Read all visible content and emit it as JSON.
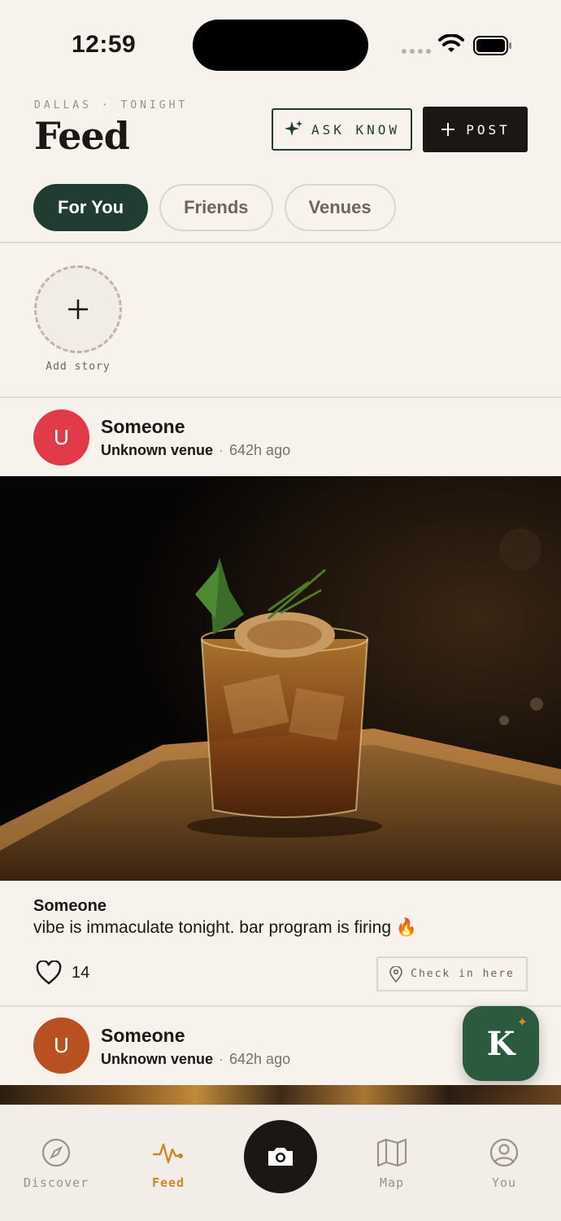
{
  "status_bar": {
    "time": "12:59"
  },
  "header": {
    "kicker": "DALLAS · TONIGHT",
    "title": "Feed",
    "ask_label": "ASK KNOW",
    "post_label": "POST"
  },
  "tabs": [
    {
      "label": "For You",
      "active": true
    },
    {
      "label": "Friends",
      "active": false
    },
    {
      "label": "Venues",
      "active": false
    }
  ],
  "stories": {
    "add_label": "Add story"
  },
  "posts": [
    {
      "avatar_letter": "U",
      "avatar_color": "#e23a48",
      "author": "Someone",
      "venue": "Unknown venue",
      "separator": "·",
      "time": "642h ago",
      "caption_author": "Someone",
      "caption": "vibe is immaculate tonight. bar program is firing 🔥",
      "likes": "14",
      "checkin_label": "Check in here"
    },
    {
      "avatar_letter": "U",
      "avatar_color": "#b9501f",
      "author": "Someone",
      "venue": "Unknown venue",
      "separator": "·",
      "time": "642h ago"
    }
  ],
  "fab": {
    "letter": "K",
    "color": "#2b5a3f"
  },
  "bottom_nav": [
    {
      "label": "Discover",
      "icon": "compass-icon",
      "active": false
    },
    {
      "label": "Feed",
      "icon": "activity-pulse-icon",
      "active": true
    },
    {
      "label": "Map",
      "icon": "map-icon",
      "active": false
    },
    {
      "label": "You",
      "icon": "user-circle-icon",
      "active": false
    }
  ],
  "colors": {
    "background": "#f7f2ec",
    "primary_green": "#1f3d30",
    "dark": "#1b1714",
    "accent": "#c48a2a"
  }
}
